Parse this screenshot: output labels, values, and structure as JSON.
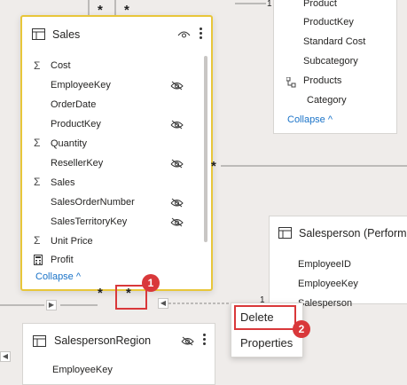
{
  "sales_table": {
    "title": "Sales",
    "fields": [
      {
        "label": "Cost",
        "sigma": true,
        "hidden": false
      },
      {
        "label": "EmployeeKey",
        "sigma": false,
        "hidden": true
      },
      {
        "label": "OrderDate",
        "sigma": false,
        "hidden": false
      },
      {
        "label": "ProductKey",
        "sigma": false,
        "hidden": true
      },
      {
        "label": "Quantity",
        "sigma": true,
        "hidden": false
      },
      {
        "label": "ResellerKey",
        "sigma": false,
        "hidden": true
      },
      {
        "label": "Sales",
        "sigma": true,
        "hidden": false
      },
      {
        "label": "SalesOrderNumber",
        "sigma": false,
        "hidden": true
      },
      {
        "label": "SalesTerritoryKey",
        "sigma": false,
        "hidden": true
      },
      {
        "label": "Unit Price",
        "sigma": true,
        "hidden": false
      },
      {
        "label": "Profit",
        "sigma": false,
        "hidden": false
      }
    ],
    "collapse_label": "Collapse"
  },
  "product_table": {
    "fields": [
      "Product",
      "ProductKey",
      "Standard Cost",
      "Subcategory",
      "Products",
      "Category"
    ],
    "collapse_label": "Collapse"
  },
  "salesperson_table": {
    "title": "Salesperson (Perform",
    "fields": [
      "EmployeeID",
      "EmployeeKey",
      "Salesperson"
    ]
  },
  "salesperson_region_table": {
    "title": "SalespersonRegion",
    "fields": [
      "EmployeeKey"
    ]
  },
  "relationship_markers": {
    "many": "*",
    "one": "1"
  },
  "context_menu": {
    "items": [
      "Delete",
      "Properties"
    ]
  },
  "callouts": [
    "1",
    "2"
  ],
  "icons": {
    "table": "table-icon",
    "hidden": "eye-slash-icon",
    "visibility": "eye-icon",
    "more": "more-options-icon",
    "sigma": "sigma-icon",
    "hierarchy": "hierarchy-icon",
    "calculator": "calculator-icon"
  },
  "colors": {
    "selection_border": "#e8c63a",
    "callout_red": "#d9383a",
    "link_blue": "#1a73c8"
  }
}
